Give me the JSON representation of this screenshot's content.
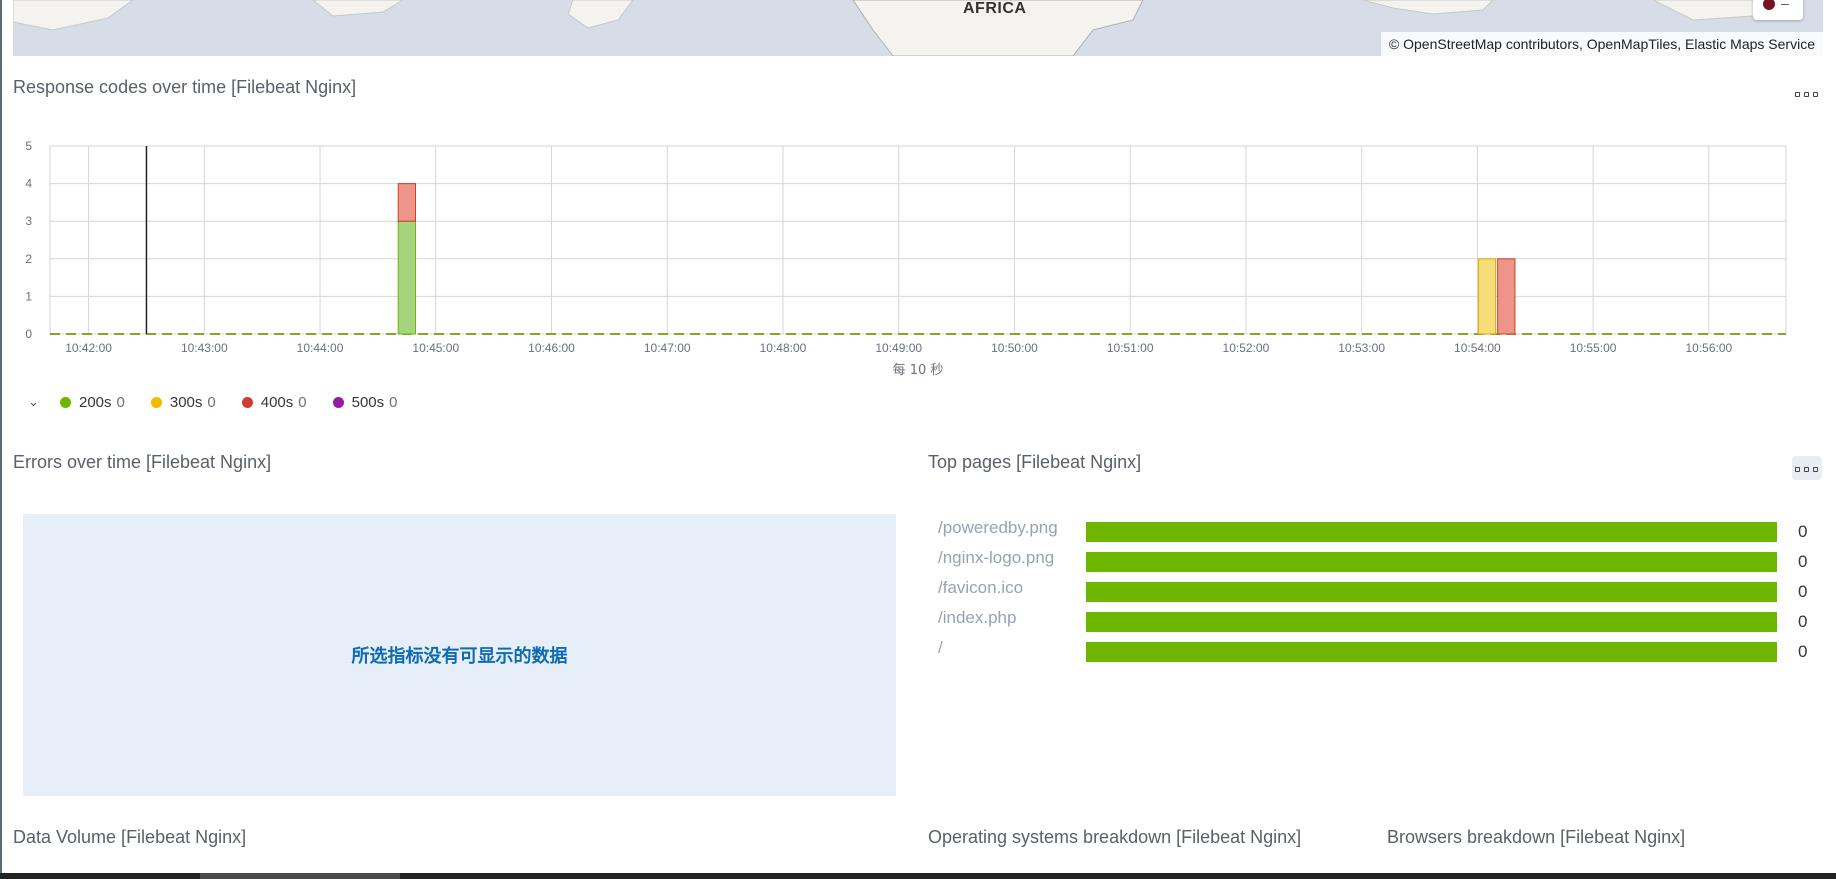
{
  "map": {
    "continent_label": "AFRICA",
    "attribution": "© OpenStreetMap contributors, OpenMapTiles, Elastic Maps Service",
    "control_dash": "–"
  },
  "response_codes": {
    "title": "Response codes over time [Filebeat Nginx]",
    "interval_label": "每 10 秒"
  },
  "chart_data": {
    "type": "bar",
    "stacked": true,
    "x_ticks": [
      "10:42:00",
      "10:43:00",
      "10:44:00",
      "10:45:00",
      "10:46:00",
      "10:47:00",
      "10:48:00",
      "10:49:00",
      "10:50:00",
      "10:51:00",
      "10:52:00",
      "10:53:00",
      "10:54:00",
      "10:55:00",
      "10:56:00"
    ],
    "x_range": [
      "10:41:40",
      "10:56:40"
    ],
    "bucket_seconds": 10,
    "ylim": [
      0,
      5
    ],
    "y_ticks": [
      0,
      1,
      2,
      3,
      4,
      5
    ],
    "grid": true,
    "current_time_marker": "10:42:30",
    "series": [
      {
        "name": "200s",
        "color": "#a6d47c",
        "border": "#6db700",
        "points": [
          {
            "x": "10:44:40",
            "y": 3
          }
        ]
      },
      {
        "name": "300s",
        "color": "#f5dd7a",
        "border": "#e0a800",
        "points": [
          {
            "x": "10:54:00",
            "y": 2
          }
        ]
      },
      {
        "name": "400s",
        "color": "#ee9488",
        "border": "#cf3d2f",
        "points": [
          {
            "x": "10:44:40",
            "y": 1
          },
          {
            "x": "10:54:10",
            "y": 2
          }
        ]
      },
      {
        "name": "500s",
        "color": "#9a1aa4",
        "border": "#9a1aa4",
        "points": []
      }
    ]
  },
  "legend": [
    {
      "label": "200s",
      "count": "0",
      "color": "#6db700"
    },
    {
      "label": "300s",
      "count": "0",
      "color": "#f5b800"
    },
    {
      "label": "400s",
      "count": "0",
      "color": "#cf3d2f"
    },
    {
      "label": "500s",
      "count": "0",
      "color": "#9a1aa4"
    }
  ],
  "errors": {
    "title": "Errors over time [Filebeat Nginx]",
    "no_data": "所选指标没有可显示的数据"
  },
  "top_pages": {
    "title": "Top pages [Filebeat Nginx]",
    "rows": [
      {
        "page": "/poweredby.png",
        "count": "0"
      },
      {
        "page": "/nginx-logo.png",
        "count": "0"
      },
      {
        "page": "/favicon.ico",
        "count": "0"
      },
      {
        "page": "/index.php",
        "count": "0"
      },
      {
        "page": "/",
        "count": "0"
      }
    ]
  },
  "bottom": {
    "data_volume": "Data Volume [Filebeat Nginx]",
    "os_breakdown": "Operating systems breakdown [Filebeat Nginx]",
    "browsers_breakdown": "Browsers breakdown [Filebeat Nginx]"
  }
}
